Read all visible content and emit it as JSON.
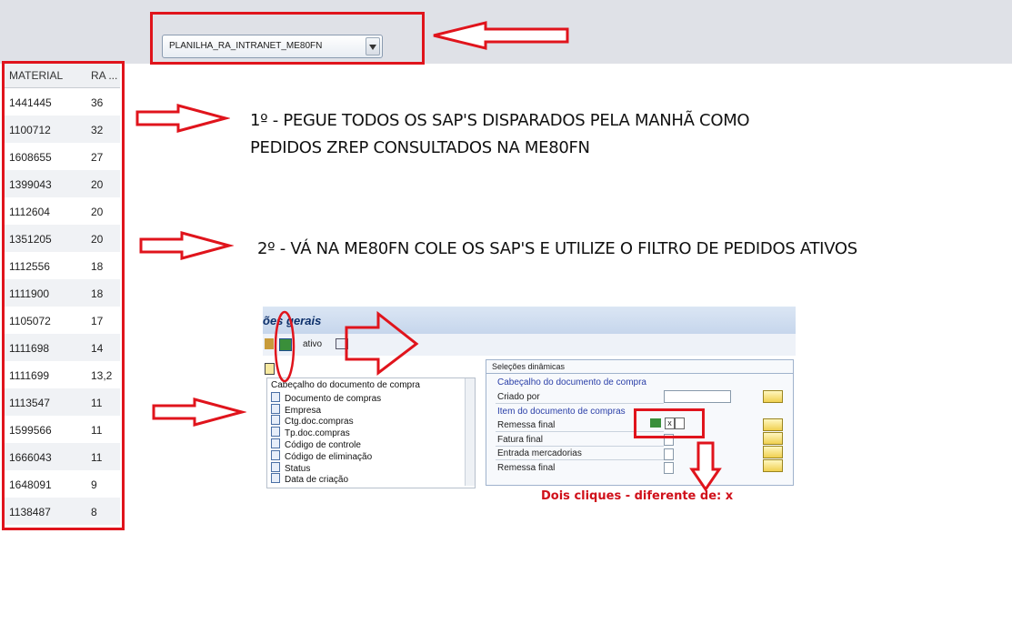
{
  "dropdown": {
    "value": "PLANILHA_RA_INTRANET_ME80FN"
  },
  "table": {
    "headers": [
      "MATERIAL",
      "RA ..."
    ],
    "rows": [
      [
        "1441445",
        "36"
      ],
      [
        "1100712",
        "32"
      ],
      [
        "1608655",
        "27"
      ],
      [
        "1399043",
        "20"
      ],
      [
        "1112604",
        "20"
      ],
      [
        "1351205",
        "20"
      ],
      [
        "1112556",
        "18"
      ],
      [
        "1111900",
        "18"
      ],
      [
        "1105072",
        "17"
      ],
      [
        "1111698",
        "14"
      ],
      [
        "1111699",
        "13,2"
      ],
      [
        "1113547",
        "11"
      ],
      [
        "1599566",
        "11"
      ],
      [
        "1666043",
        "11"
      ],
      [
        "1648091",
        "9"
      ],
      [
        "1138487",
        "8"
      ]
    ]
  },
  "instructions": {
    "step1_line1": "1º - PEGUE TODOS OS SAP'S DISPARADOS PELA MANHÃ COMO",
    "step1_line2": "PEDIDOS ZREP CONSULTADOS NA ME80FN",
    "step2": "2º - VÁ NA ME80FN COLE OS SAP'S E UTILIZE O FILTRO DE PEDIDOS ATIVOS"
  },
  "sap": {
    "header_title": "ões gerais",
    "toolbar_label": "ativo",
    "tree_items": [
      "Cabeçalho do documento de compra",
      "Documento de compras",
      "Empresa",
      "Ctg.doc.compras",
      "Tp.doc.compras",
      "Código de controle",
      "Código de eliminação",
      "Status",
      "Data de criação"
    ],
    "panel_title": "Seleções dinâmicas",
    "group1": "Cabeçalho do documento de compra",
    "criado_por": "Criado por",
    "group2": "Item do documento de compras",
    "fields": [
      "Remessa final",
      "Fatura final",
      "Entrada mercadorias",
      "Remessa final"
    ],
    "note": "Dois cliques - diferente de: x"
  },
  "colors": {
    "highlight": "#e0141c"
  }
}
